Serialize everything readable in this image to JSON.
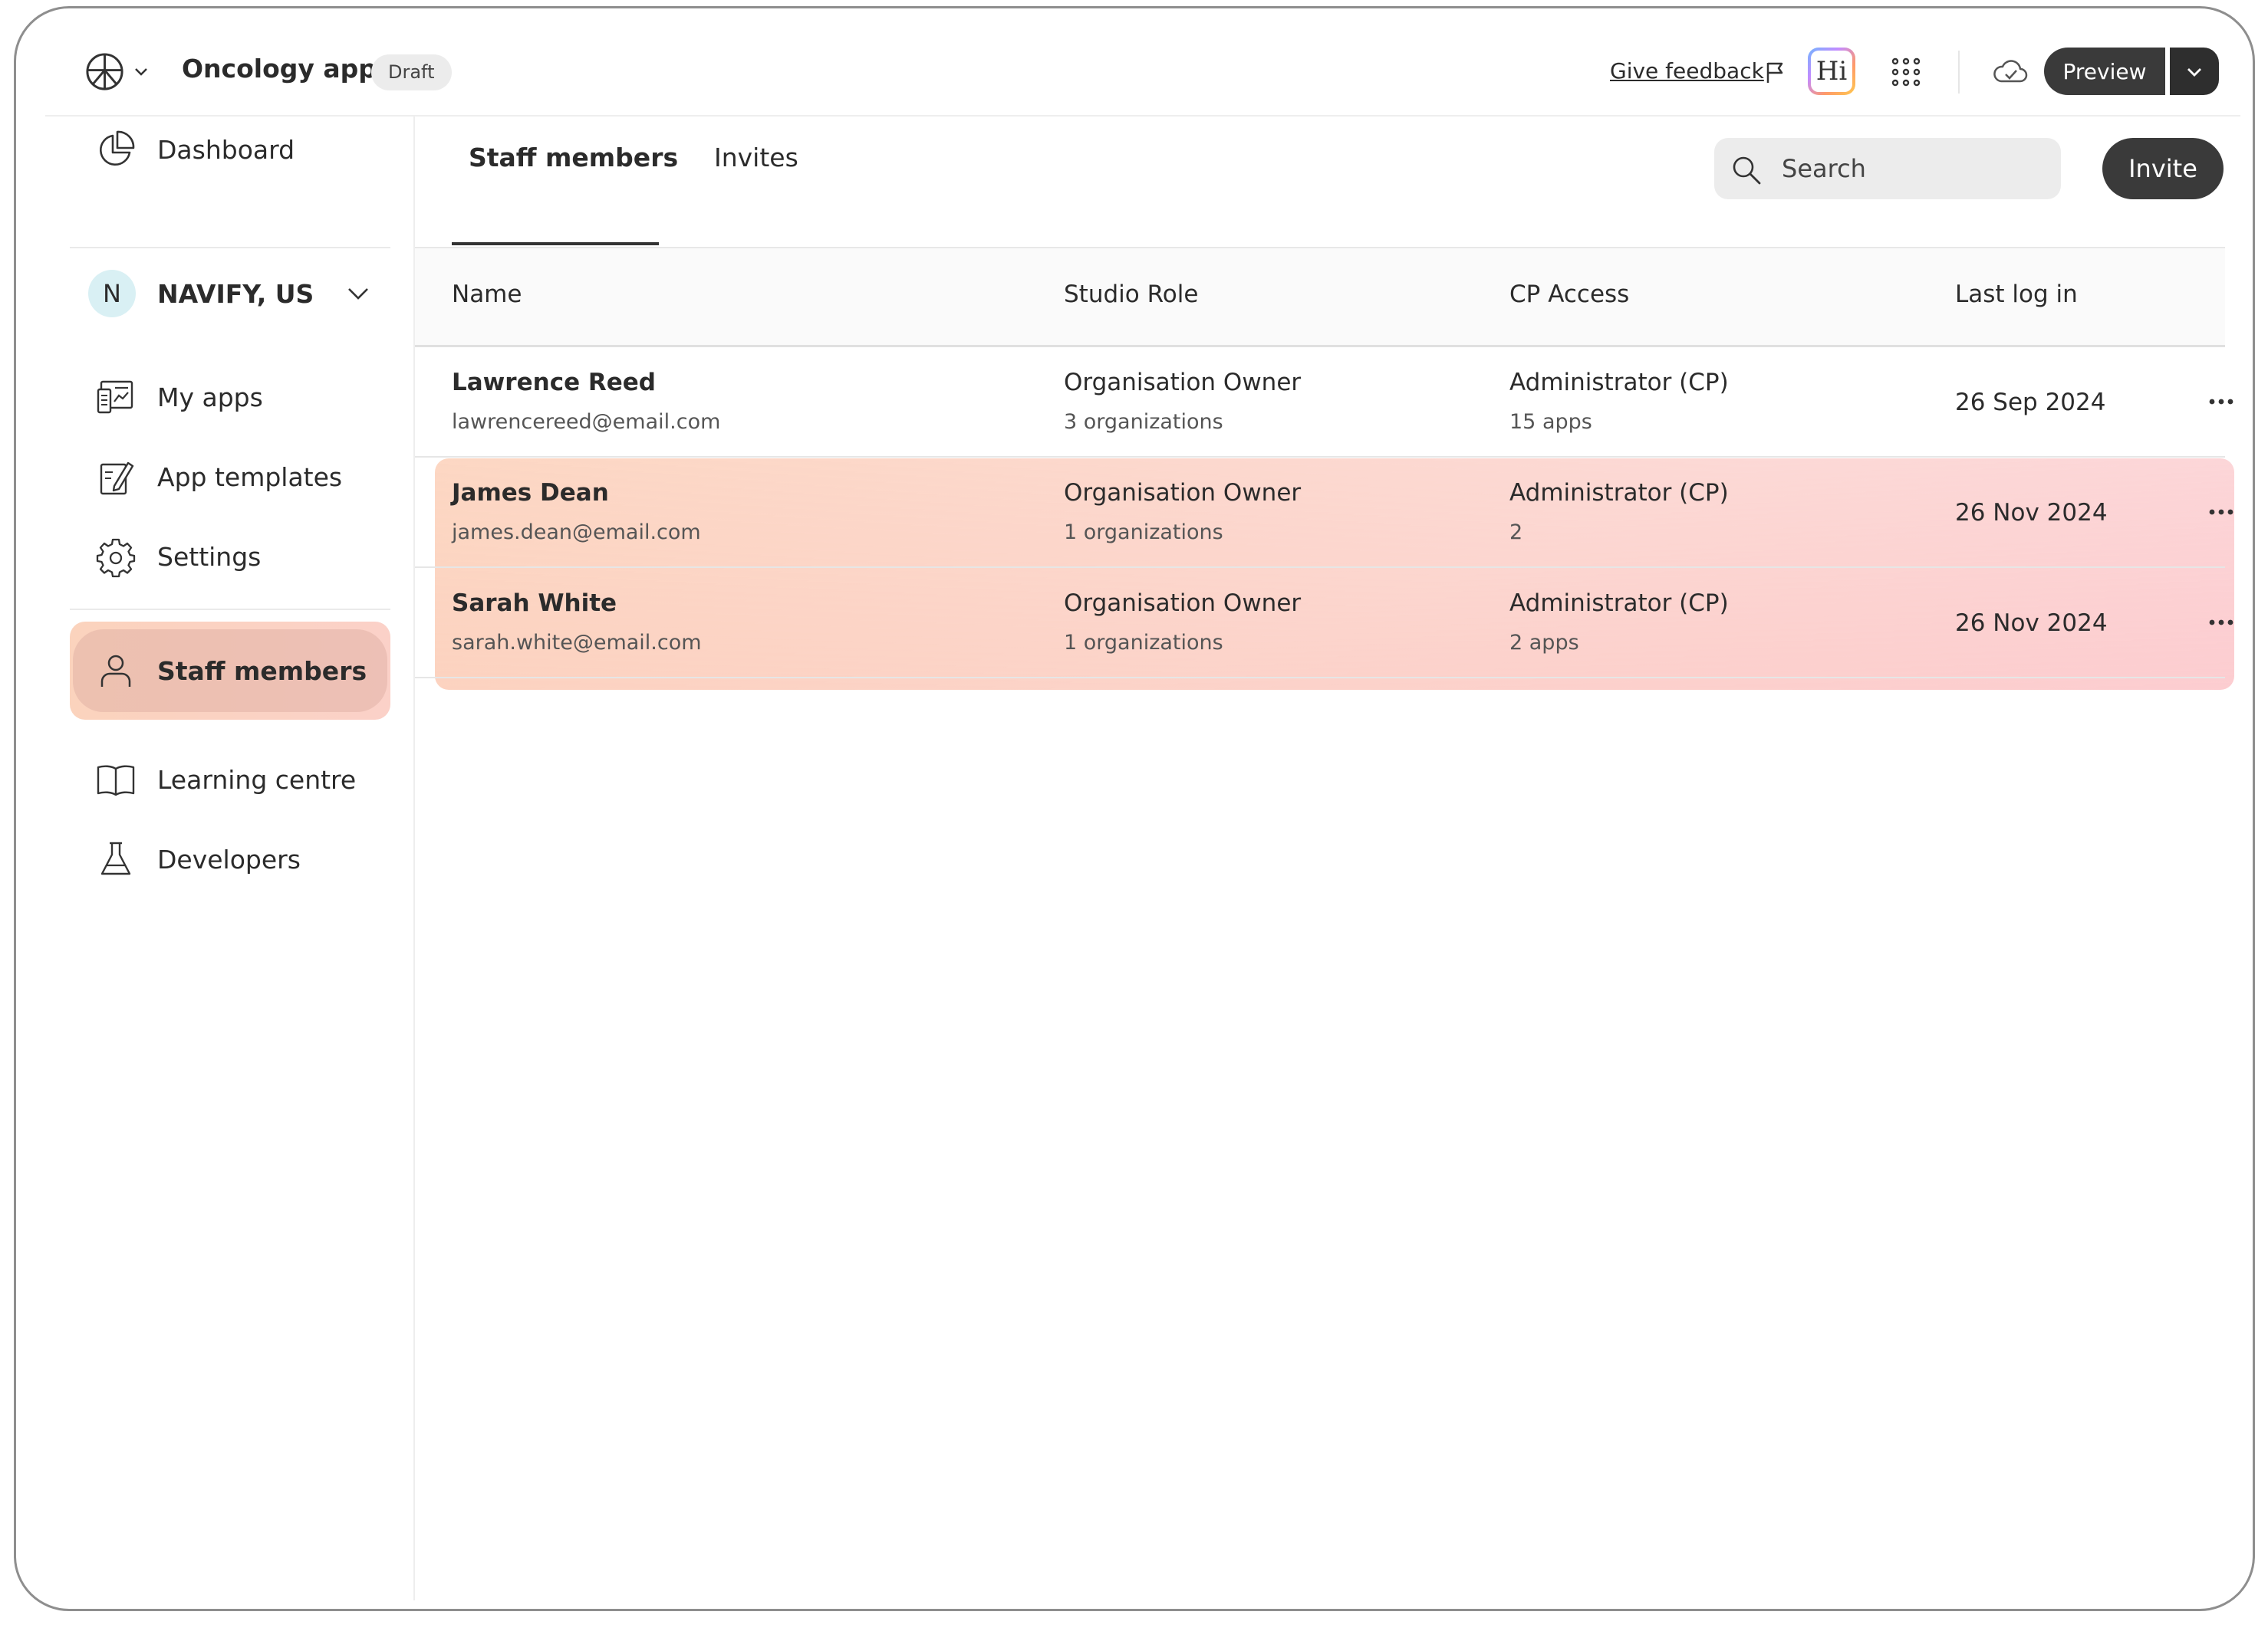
{
  "header": {
    "app_name": "Oncology app",
    "status_badge": "Draft",
    "feedback_label": "Give feedback",
    "hi_label": "Hi",
    "preview_label": "Preview"
  },
  "sidebar": {
    "dashboard": "Dashboard",
    "org": {
      "initial": "N",
      "name": "NAVIFY, US"
    },
    "items": [
      {
        "label": "My apps"
      },
      {
        "label": "App templates"
      },
      {
        "label": "Settings"
      }
    ],
    "bottom_items": [
      {
        "label": "Staff members",
        "active": true
      },
      {
        "label": "Learning centre"
      },
      {
        "label": "Developers"
      }
    ]
  },
  "tabs": [
    {
      "label": "Staff members",
      "active": true
    },
    {
      "label": "Invites"
    }
  ],
  "search": {
    "placeholder": "Search"
  },
  "invite_label": "Invite",
  "table": {
    "columns": [
      "Name",
      "Studio Role",
      "CP Access",
      "Last log in"
    ],
    "rows": [
      {
        "name": "Lawrence Reed",
        "email": "lawrencereed@email.com",
        "role": "Organisation Owner",
        "orgs": "3 organizations",
        "access": "Administrator (CP)",
        "apps": "15 apps",
        "last_login": "26 Sep 2024"
      },
      {
        "name": "James Dean",
        "email": "james.dean@email.com",
        "role": "Organisation Owner",
        "orgs": "1 organizations",
        "access": "Administrator (CP)",
        "apps": "2",
        "last_login": "26 Nov 2024"
      },
      {
        "name": "Sarah White",
        "email": "sarah.white@email.com",
        "role": "Organisation Owner",
        "orgs": "1 organizations",
        "access": "Administrator (CP)",
        "apps": "2 apps",
        "last_login": "26 Nov 2024"
      }
    ]
  },
  "colors": {
    "primary_button": "#3a3a3a",
    "highlight_start": "#fbd3bd",
    "highlight_end": "#fbcfd6",
    "org_avatar": "#d9f0f4"
  }
}
